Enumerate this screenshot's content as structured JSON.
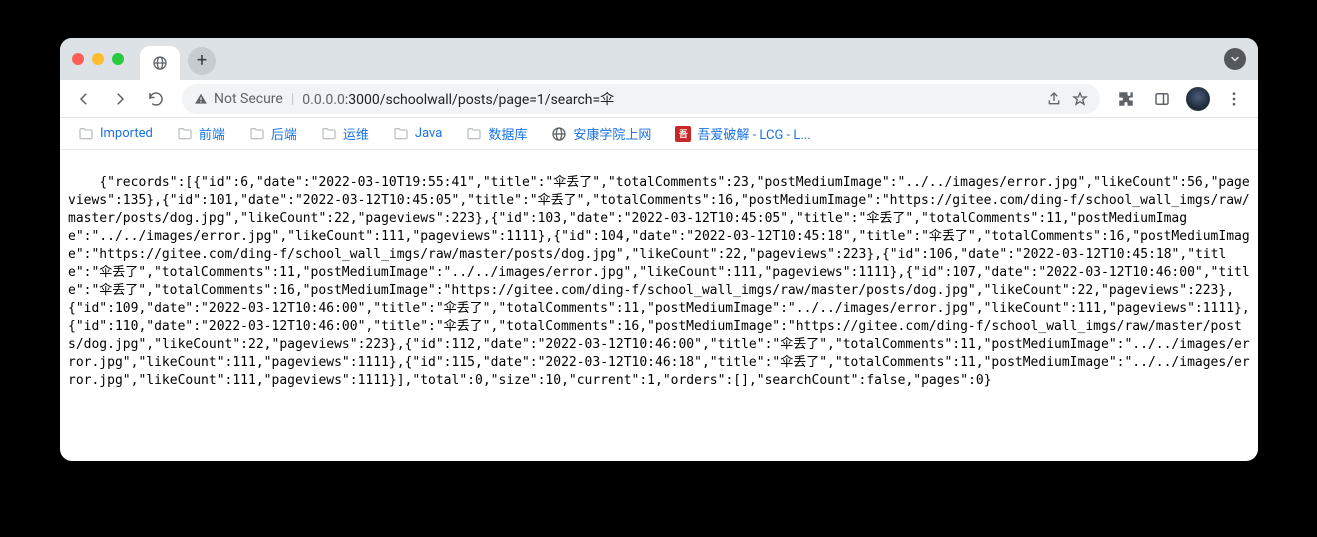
{
  "window": {
    "traffic": [
      "close",
      "minimize",
      "zoom"
    ]
  },
  "tab": {
    "icon": "globe"
  },
  "newtab_label": "+",
  "toolbar": {
    "back": "Back",
    "forward": "Forward",
    "reload": "Reload",
    "not_secure_label": "Not Secure",
    "url_dim": "0.0.0.0",
    "url_rest": ":3000/schoolwall/posts/page=1/search=伞",
    "share": "Share",
    "star": "Bookmark",
    "extensions": "Extensions",
    "panel": "Side panel",
    "menu": "Menu"
  },
  "bookmarks": [
    {
      "label": "Imported",
      "type": "folder"
    },
    {
      "label": "前端",
      "type": "folder"
    },
    {
      "label": "后端",
      "type": "folder"
    },
    {
      "label": "运维",
      "type": "folder"
    },
    {
      "label": "Java",
      "type": "folder"
    },
    {
      "label": "数据库",
      "type": "folder"
    },
    {
      "label": "安康学院上网",
      "type": "site",
      "icon": "globe"
    },
    {
      "label": "吾爱破解 - LCG - L...",
      "type": "site",
      "icon": "red52"
    }
  ],
  "body_text": "{\"records\":[{\"id\":6,\"date\":\"2022-03-10T19:55:41\",\"title\":\"伞丢了\",\"totalComments\":23,\"postMediumImage\":\"../../images/error.jpg\",\"likeCount\":56,\"pageviews\":135},{\"id\":101,\"date\":\"2022-03-12T10:45:05\",\"title\":\"伞丢了\",\"totalComments\":16,\"postMediumImage\":\"https://gitee.com/ding-f/school_wall_imgs/raw/master/posts/dog.jpg\",\"likeCount\":22,\"pageviews\":223},{\"id\":103,\"date\":\"2022-03-12T10:45:05\",\"title\":\"伞丢了\",\"totalComments\":11,\"postMediumImage\":\"../../images/error.jpg\",\"likeCount\":111,\"pageviews\":1111},{\"id\":104,\"date\":\"2022-03-12T10:45:18\",\"title\":\"伞丢了\",\"totalComments\":16,\"postMediumImage\":\"https://gitee.com/ding-f/school_wall_imgs/raw/master/posts/dog.jpg\",\"likeCount\":22,\"pageviews\":223},{\"id\":106,\"date\":\"2022-03-12T10:45:18\",\"title\":\"伞丢了\",\"totalComments\":11,\"postMediumImage\":\"../../images/error.jpg\",\"likeCount\":111,\"pageviews\":1111},{\"id\":107,\"date\":\"2022-03-12T10:46:00\",\"title\":\"伞丢了\",\"totalComments\":16,\"postMediumImage\":\"https://gitee.com/ding-f/school_wall_imgs/raw/master/posts/dog.jpg\",\"likeCount\":22,\"pageviews\":223},{\"id\":109,\"date\":\"2022-03-12T10:46:00\",\"title\":\"伞丢了\",\"totalComments\":11,\"postMediumImage\":\"../../images/error.jpg\",\"likeCount\":111,\"pageviews\":1111},{\"id\":110,\"date\":\"2022-03-12T10:46:00\",\"title\":\"伞丢了\",\"totalComments\":16,\"postMediumImage\":\"https://gitee.com/ding-f/school_wall_imgs/raw/master/posts/dog.jpg\",\"likeCount\":22,\"pageviews\":223},{\"id\":112,\"date\":\"2022-03-12T10:46:00\",\"title\":\"伞丢了\",\"totalComments\":11,\"postMediumImage\":\"../../images/error.jpg\",\"likeCount\":111,\"pageviews\":1111},{\"id\":115,\"date\":\"2022-03-12T10:46:18\",\"title\":\"伞丢了\",\"totalComments\":11,\"postMediumImage\":\"../../images/error.jpg\",\"likeCount\":111,\"pageviews\":1111}],\"total\":0,\"size\":10,\"current\":1,\"orders\":[],\"searchCount\":false,\"pages\":0}"
}
